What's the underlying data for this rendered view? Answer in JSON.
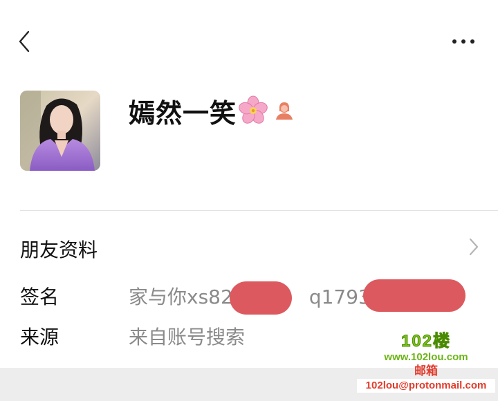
{
  "header": {
    "back_icon": "chevron-left-icon",
    "more_icon": "more-dots-icon"
  },
  "profile": {
    "nickname": "嫣然一笑",
    "emoji_icon": "cherry-blossom-icon",
    "gender_icon": "female-user-icon",
    "avatar_icon": "user-avatar-photo"
  },
  "friend_section": {
    "title": "朋友资料",
    "chevron_icon": "chevron-right-icon"
  },
  "info": [
    {
      "label": "签名",
      "value_part1": "家与你xs82",
      "value_sep": "，",
      "value_part2": "q1793"
    },
    {
      "label": "来源",
      "value": "来自账号搜索"
    }
  ],
  "watermark": {
    "brand": "102楼",
    "url": "www.102lou.com",
    "mail_label": "邮箱",
    "mail": "102lou@protonmail.com"
  },
  "colors": {
    "redact": "#dc5a5f",
    "secondary_text": "#8a8a8a",
    "divider": "#e2e2e2"
  }
}
